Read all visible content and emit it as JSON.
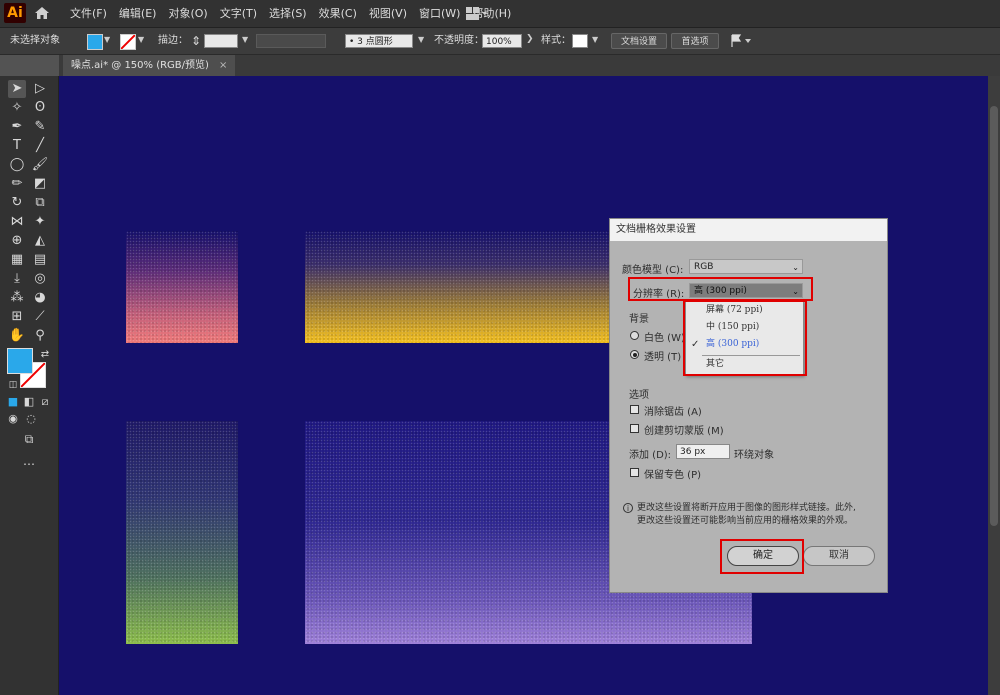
{
  "app": {
    "logo_text": "Ai"
  },
  "menu": [
    "文件(F)",
    "编辑(E)",
    "对象(O)",
    "文字(T)",
    "选择(S)",
    "效果(C)",
    "视图(V)",
    "窗口(W)",
    "帮助(H)"
  ],
  "control_bar": {
    "selection_status": "未选择对象",
    "stroke_label": "描边：",
    "brush_value": "•  3 点圆形",
    "opacity_label": "不透明度：",
    "opacity_value": "100%",
    "style_label": "样式：",
    "doc_setup_button": "文档设置",
    "preferences_button": "首选项",
    "fill_color": "#2aa8ea"
  },
  "document_tab": {
    "title": "噪点.ai* @ 150% (RGB/预览)",
    "close": "×"
  },
  "dialog": {
    "title": "文档栅格效果设置",
    "color_model_label": "颜色模型 (C):",
    "color_model_value": "RGB",
    "resolution_label": "分辨率 (R):",
    "resolution_value": "高 (300 ppi)",
    "resolution_options": [
      "屏幕 (72 ppi)",
      "中 (150 ppi)",
      "高 (300 ppi)",
      "其它"
    ],
    "background_label": "背景",
    "bg_white": "白色 (W)",
    "bg_transparent": "透明 (T)",
    "options_label": "选项",
    "opt_antialias": "消除锯齿 (A)",
    "opt_clipping_mask": "创建剪切蒙版 (M)",
    "add_label": "添加 (D):",
    "add_value": "36 px",
    "add_suffix": "环绕对象",
    "opt_spot_colors": "保留专色 (P)",
    "note_line1": "更改这些设置将断开应用于图像的图形样式链接。此外,",
    "note_line2": "更改这些设置还可能影响当前应用的栅格效果的外观。",
    "ok": "确定",
    "cancel": "取消"
  },
  "colors": {
    "canvas": "#15106a",
    "highlight": "#e00000",
    "accent": "#2aa8ea"
  }
}
